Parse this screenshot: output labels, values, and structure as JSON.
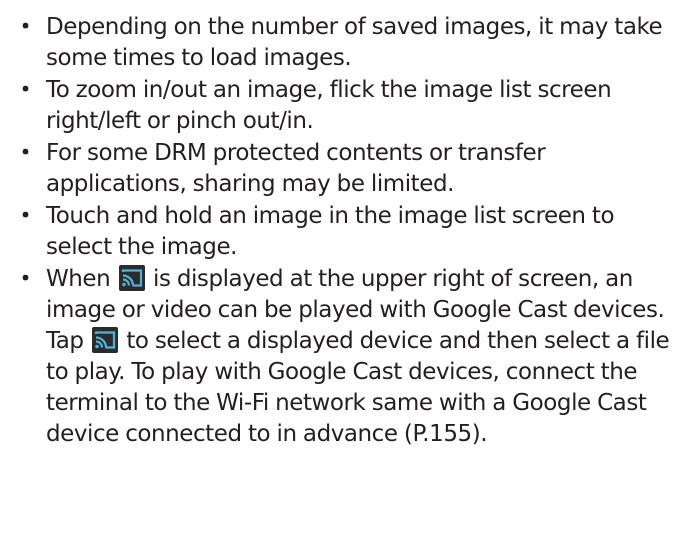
{
  "bullet_char": "・",
  "icons": {
    "cast": {
      "name": "google-cast-icon",
      "bg": "#2b2b2b",
      "fg": "#4fb3d9"
    }
  },
  "notes": [
    {
      "text": "Depending on the number of saved images, it may take some times to load images."
    },
    {
      "text": "To zoom in/out an image, flick the image list screen right/left or pinch out/in."
    },
    {
      "text": "For some DRM protected contents or transfer applications, sharing may be limited."
    },
    {
      "text": "Touch and hold an image in the image list screen to select the image."
    },
    {
      "part1": "When",
      "part2": "is displayed at the upper right of screen, an image or video can be played with Google Cast devices. Tap",
      "part3": "to select a displayed device and then select a file to play. To play with Google Cast devices, connect the terminal to the Wi-Fi network same with a Google Cast device connected to in advance (P.155)."
    }
  ]
}
